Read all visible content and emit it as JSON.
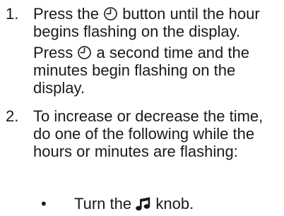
{
  "steps": [
    {
      "number": "1.",
      "text_a": "Press the",
      "icon_1": "clock-icon",
      "text_b": "button until the hour begins flashing on the display.",
      "text_c": "Press",
      "icon_2": "clock-icon",
      "text_d": "a second time and the minutes begin flashing on the display."
    },
    {
      "number": "2.",
      "text": "To increase or decrease the time, do one of the following while the hours or minutes are flashing:"
    }
  ],
  "bullet": {
    "marker": "•",
    "text_a": "Turn the",
    "icon": "music-note-icon",
    "text_b": "knob."
  }
}
